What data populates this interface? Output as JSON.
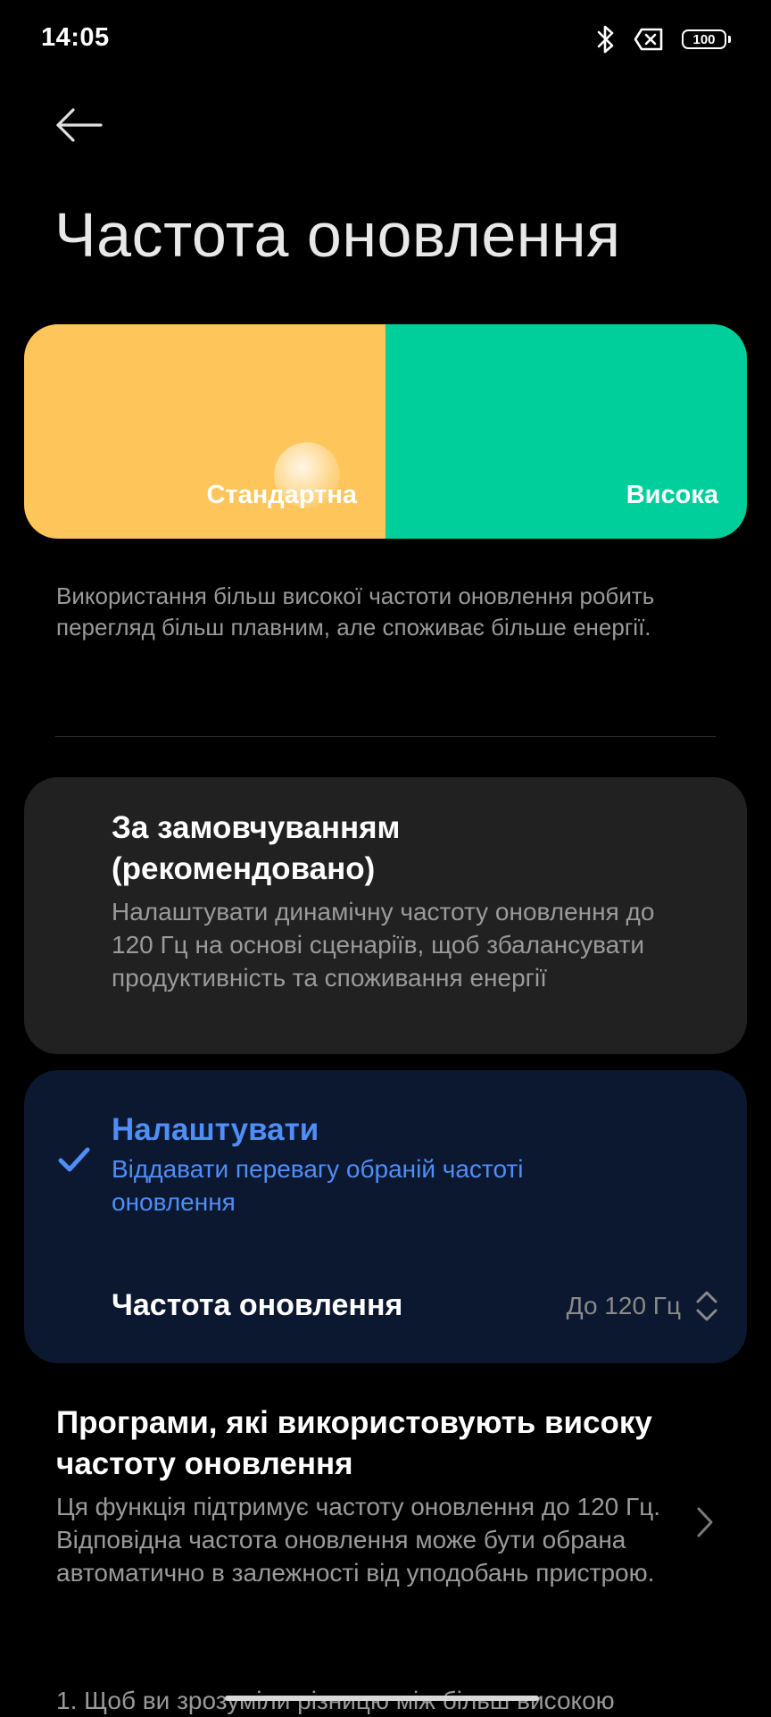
{
  "status_bar": {
    "time": "14:05",
    "battery_level": "100",
    "icons": [
      "bluetooth-icon",
      "no-sim-icon",
      "battery-icon"
    ]
  },
  "header": {
    "title": "Частота оновлення",
    "back_icon": "arrow-left-icon"
  },
  "mode_switch": {
    "standard_label": "Стандартна",
    "high_label": "Висока",
    "colors": {
      "standard": "#fec55a",
      "high": "#00cf9b"
    }
  },
  "description": "Використання більш високої частоти оновлення робить перегляд більш плавним, але споживає більше енергії.",
  "options": {
    "default": {
      "title": "За замовчуванням (рекомендовано)",
      "subtitle": "Налаштувати динамічну частоту оновлення до 120 Гц на основі сценаріїв, щоб збалансувати продуктивність та споживання енергії",
      "selected": false
    },
    "custom": {
      "title": "Налаштувати",
      "subtitle": "Віддавати перевагу обраній частоті оновлення",
      "selected": true,
      "rate_label": "Частота оновлення",
      "rate_value": "До 120 Гц"
    }
  },
  "apps_section": {
    "title": "Програми, які використовують високу частоту оновлення",
    "subtitle": "Ця функція підтримує частоту оновлення до 120 Гц. Відповідна частота оновлення може бути обрана автоматично в залежності від уподобань пристрою."
  },
  "footnote": "1. Щоб ви зрозуміли різницю між більш високою",
  "accent_color": "#4f8ef7"
}
